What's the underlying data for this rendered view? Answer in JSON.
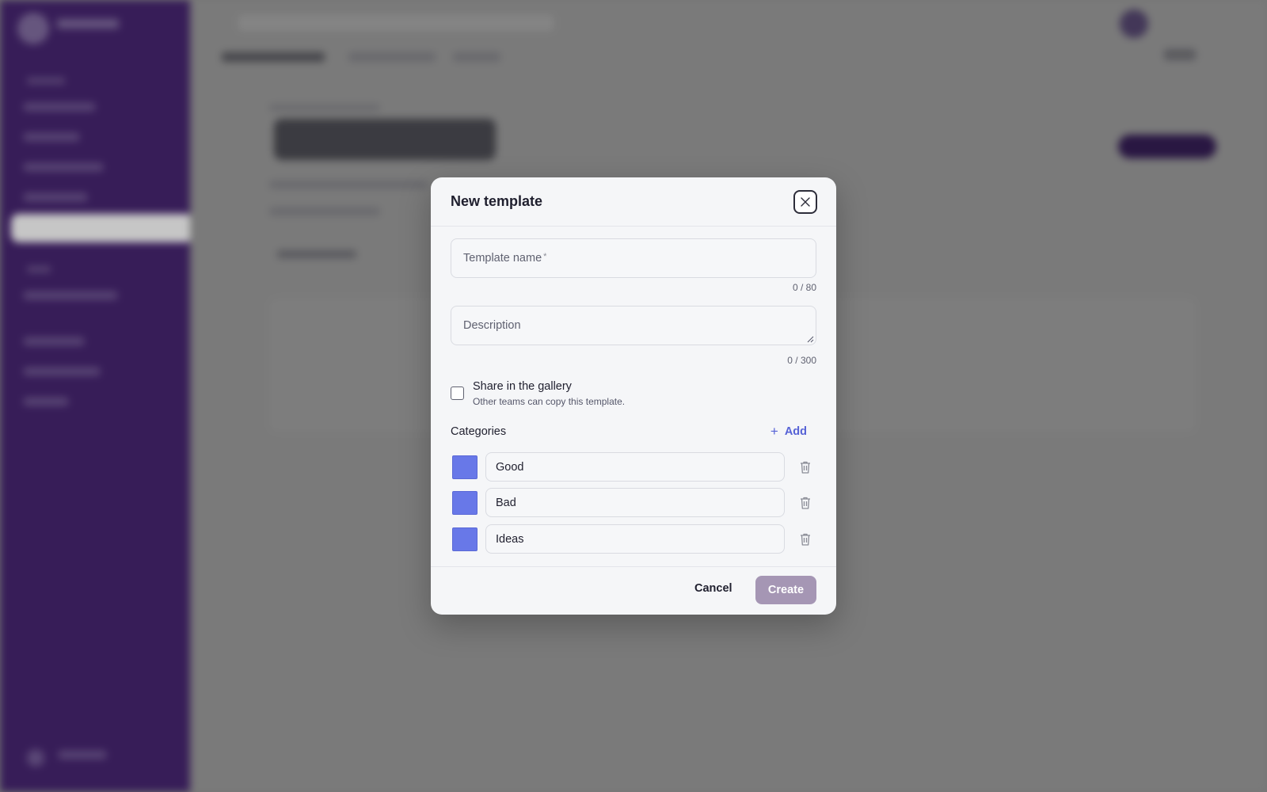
{
  "modal": {
    "title": "New template",
    "close_icon": "close-icon",
    "name_field": {
      "placeholder": "Template name",
      "required_mark": "*",
      "value": "",
      "counter": "0 / 80"
    },
    "description_field": {
      "placeholder": "Description",
      "value": "",
      "counter": "0 / 300"
    },
    "share": {
      "label": "Share in the gallery",
      "hint": "Other teams can copy this template.",
      "checked": false
    },
    "categories": {
      "title": "Categories",
      "add_label": "Add",
      "items": [
        {
          "name": "Good",
          "color": "#6878e8"
        },
        {
          "name": "Bad",
          "color": "#6878e8"
        },
        {
          "name": "Ideas",
          "color": "#6878e8"
        }
      ]
    },
    "footer": {
      "cancel_label": "Cancel",
      "create_label": "Create"
    }
  },
  "colors": {
    "sidebar": "#3a1f5c",
    "accent": "#5662d6",
    "create_button": "#a596b4",
    "swatch": "#6878e8"
  }
}
